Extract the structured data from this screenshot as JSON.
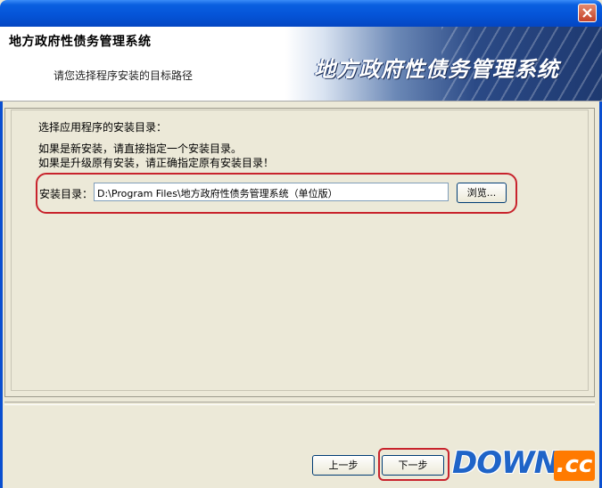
{
  "header": {
    "title": "地方政府性债务管理系统",
    "subtitle": "请您选择程序安装的目标路径",
    "banner_text": "地方政府性债务管理系统"
  },
  "content": {
    "line1": "选择应用程序的安装目录：",
    "line2": "如果是新安装，请直接指定一个安装目录。",
    "line3": "如果是升级原有安装，请正确指定原有安装目录！",
    "install_label": "安装目录：",
    "install_path": "D:\\Program Files\\地方政府性债务管理系统（单位版）",
    "browse_label": "浏览..."
  },
  "footer": {
    "prev_label": "上一步",
    "next_label": "下一步"
  },
  "watermark": {
    "down": "DOWN",
    "cc": ".cc"
  },
  "colors": {
    "titlebar": "#0554d8",
    "highlight": "#c8232c",
    "dialog_bg": "#ece9d8"
  },
  "icons": {
    "close": "close-icon"
  }
}
